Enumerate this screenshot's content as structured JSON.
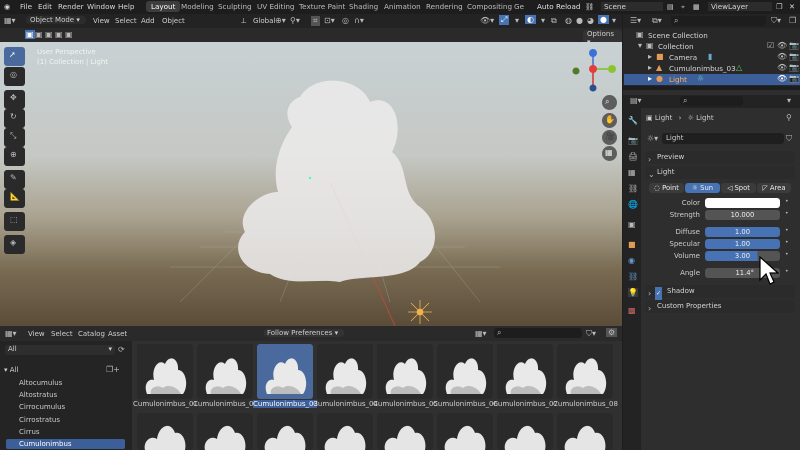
{
  "menu": {
    "file": "File",
    "edit": "Edit",
    "render": "Render",
    "window": "Window",
    "help": "Help"
  },
  "workspaces": [
    "Layout",
    "Modeling",
    "Sculpting",
    "UV Editing",
    "Texture Paint",
    "Shading",
    "Animation",
    "Rendering",
    "Compositing",
    "Ge"
  ],
  "auto_reload": "Auto Reload",
  "scene": "Scene",
  "view_layer": "ViewLayer",
  "viewport": {
    "mode": "Object Mode",
    "view": "View",
    "select": "Select",
    "add": "Add",
    "object": "Object",
    "orientation": "Global",
    "options": "Options",
    "overlay_title": "User Perspective",
    "overlay_sub": "(1) Collection | Light"
  },
  "outliner": {
    "root": "Scene Collection",
    "collection": "Collection",
    "items": [
      "Camera",
      "Cumulonimbus_03",
      "Light"
    ]
  },
  "properties": {
    "breadcrumb_obj": "Light",
    "breadcrumb_data": "Light",
    "datablock": "Light",
    "preview": "Preview",
    "light_panel": "Light",
    "types": [
      "Point",
      "Sun",
      "Spot",
      "Area"
    ],
    "active_type": "Sun",
    "color_label": "Color",
    "strength_label": "Strength",
    "strength": "10.000",
    "diffuse_label": "Diffuse",
    "diffuse": "1.00",
    "specular_label": "Specular",
    "specular": "1.00",
    "volume_label": "Volume",
    "volume": "3.00",
    "angle_label": "Angle",
    "angle": "11.4°",
    "shadow": "Shadow",
    "custom": "Custom Properties"
  },
  "asset_browser": {
    "view": "View",
    "select": "Select",
    "catalog": "Catalog",
    "asset": "Asset",
    "import": "Follow Preferences",
    "library": "All",
    "tree_root": "All",
    "categories": [
      "Altocumulus",
      "Altostratus",
      "Cirrocumulus",
      "Cirrostratus",
      "Cirrus",
      "Cumulonimbus"
    ],
    "active_category": "Cumulonimbus",
    "assets": [
      "Cumulonimbus_01",
      "Cumulonimbus_02",
      "Cumulonimbus_03",
      "Cumulonimbus_04",
      "Cumulonimbus_05",
      "Cumulonimbus_06",
      "Cumulonimbus_07",
      "Cumulonimbus_08"
    ],
    "selected_asset": "Cumulonimbus_03"
  },
  "colors": {
    "accent": "#4772b3",
    "selection": "#3d5f99",
    "light_icon": "#e39a52"
  }
}
